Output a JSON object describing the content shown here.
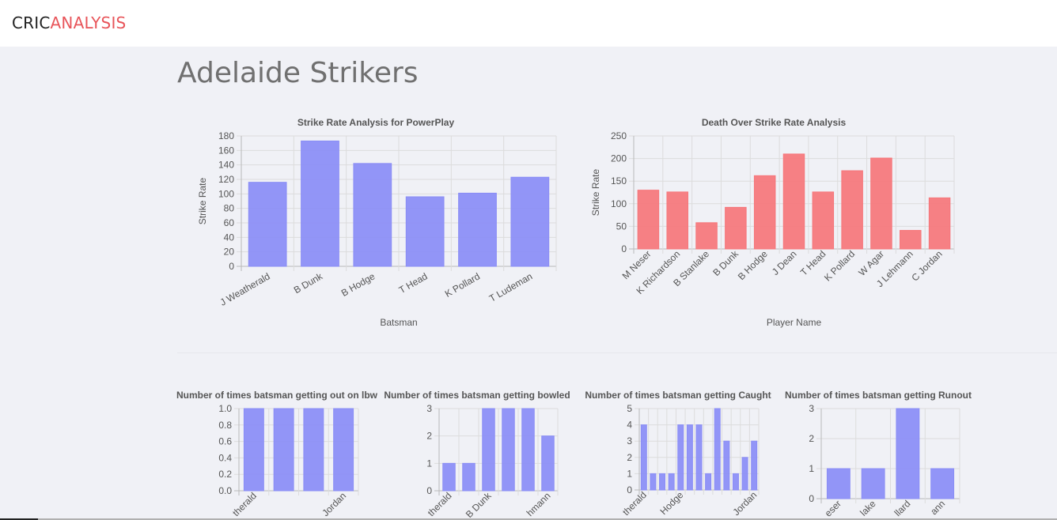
{
  "brand": {
    "part1": "CRIC",
    "part2": "ANALYSIS"
  },
  "page": {
    "title": "Adelaide Strikers"
  },
  "colors": {
    "blue": "#8a8df6",
    "red": "#f6767a"
  },
  "chart_data": [
    {
      "id": "powerplay",
      "type": "bar",
      "title": "Strike Rate Analysis for PowerPlay",
      "xlabel": "Batsman",
      "ylabel": "Strike Rate",
      "categories": [
        "J Weatherald",
        "B Dunk",
        "B Hodge",
        "T Head",
        "K Pollard",
        "T Ludeman"
      ],
      "values": [
        116,
        173,
        142,
        96,
        101,
        123
      ],
      "ylim": [
        0,
        180
      ],
      "ytick_step": 20,
      "decimals": 0,
      "color": "blue",
      "grid": true
    },
    {
      "id": "death",
      "type": "bar",
      "title": "Death Over Strike Rate Analysis",
      "xlabel": "Player Name",
      "ylabel": "Strike Rate",
      "categories": [
        "M Neser",
        "K Richardson",
        "B Stanlake",
        "B Dunk",
        "B Hodge",
        "J Dean",
        "T Head",
        "K Pollard",
        "W Agar",
        "J Lehmann",
        "C Jordan"
      ],
      "values": [
        130,
        126,
        58,
        92,
        162,
        210,
        126,
        173,
        201,
        41,
        113
      ],
      "ylim": [
        0,
        250
      ],
      "ytick_step": 50,
      "decimals": 0,
      "color": "red",
      "grid": true
    },
    {
      "id": "lbw",
      "type": "bar",
      "title": "Number of times batsman getting out on lbw",
      "xlabel": "",
      "ylabel": "",
      "categories": [
        "J Weatherald",
        "",
        "",
        "C Jordan"
      ],
      "display_labels": [
        "therald",
        "",
        "",
        "Jordan"
      ],
      "values": [
        1,
        1,
        1,
        1
      ],
      "ylim": [
        0,
        1.0
      ],
      "ytick_step": 0.2,
      "decimals": 1,
      "color": "blue",
      "grid": true
    },
    {
      "id": "bowled",
      "type": "bar",
      "title": "Number of times batsman getting bowled",
      "xlabel": "",
      "ylabel": "",
      "categories": [
        "J Weatherald",
        "",
        "B Dunk",
        "",
        "",
        "J Lehmann"
      ],
      "display_labels": [
        "therald",
        "",
        "B Dunk",
        "",
        "",
        "hmann"
      ],
      "values": [
        1,
        1,
        3,
        3,
        3,
        2
      ],
      "ylim": [
        0,
        3
      ],
      "ytick_step": 1,
      "decimals": 0,
      "color": "blue",
      "grid": true
    },
    {
      "id": "caught",
      "type": "bar",
      "title": "Number of times batsman getting Caught",
      "xlabel": "",
      "ylabel": "",
      "categories": [
        "J Weatherald",
        "",
        "",
        "",
        "B Hodge",
        "",
        "",
        "",
        "",
        "",
        "",
        "",
        "C Jordan"
      ],
      "display_labels": [
        "therald",
        "",
        "",
        "",
        "Hodge",
        "",
        "",
        "",
        "",
        "",
        "",
        "",
        "Jordan"
      ],
      "values": [
        4,
        1,
        1,
        1,
        4,
        4,
        4,
        1,
        5,
        3,
        1,
        2,
        3
      ],
      "ylim": [
        0,
        5
      ],
      "ytick_step": 1,
      "decimals": 0,
      "color": "blue",
      "grid": true
    },
    {
      "id": "runout",
      "type": "bar",
      "title": "Number of times batsman getting Runout",
      "xlabel": "",
      "ylabel": "",
      "categories": [
        "M Neser",
        "B Stanlake",
        "K Pollard",
        "J Lehmann"
      ],
      "display_labels": [
        "eser",
        "lake",
        "llard",
        "ann"
      ],
      "values": [
        1,
        1,
        3,
        1
      ],
      "ylim": [
        0,
        3
      ],
      "ytick_step": 1,
      "decimals": 0,
      "color": "blue",
      "grid": true
    }
  ]
}
